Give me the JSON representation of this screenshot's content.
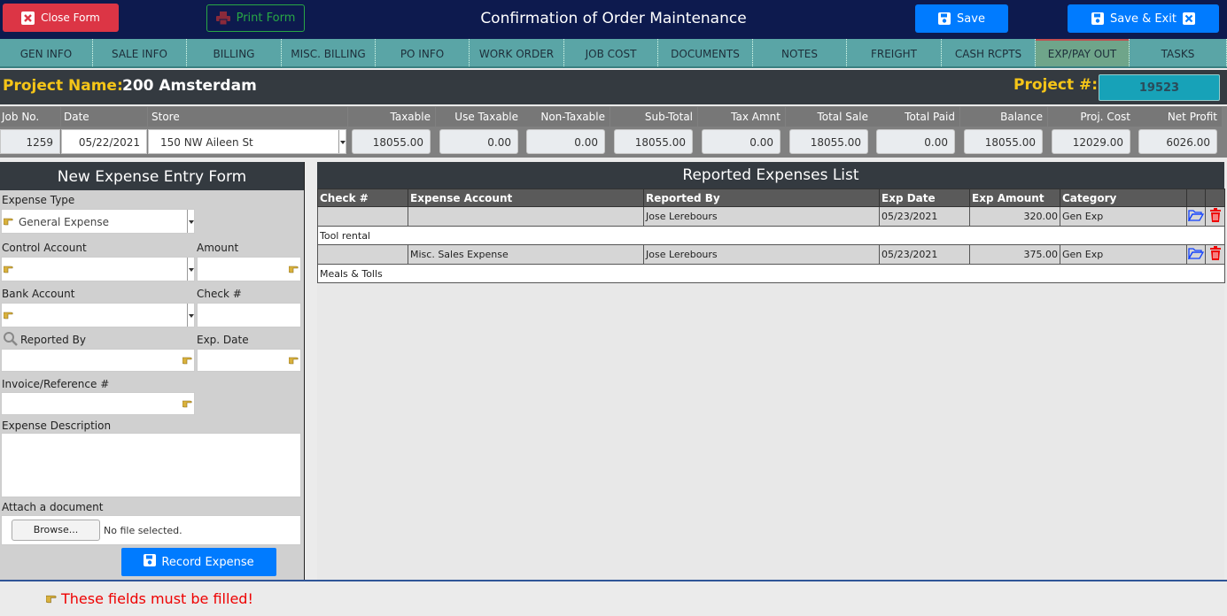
{
  "header": {
    "title": "Confirmation of Order Maintenance",
    "close_label": "Close Form",
    "print_label": "Print Form",
    "save_label": "Save",
    "save_exit_label": "Save & Exit"
  },
  "tabs": [
    {
      "label": "GEN INFO",
      "w": 105
    },
    {
      "label": "SALE INFO",
      "w": 106
    },
    {
      "label": "BILLING",
      "w": 107
    },
    {
      "label": "MISC. BILLING",
      "w": 106
    },
    {
      "label": "PO INFO",
      "w": 106
    },
    {
      "label": "WORK ORDER",
      "w": 107
    },
    {
      "label": "JOB COST",
      "w": 106
    },
    {
      "label": "DOCUMENTS",
      "w": 107
    },
    {
      "label": "NOTES",
      "w": 106
    },
    {
      "label": "FREIGHT",
      "w": 107
    },
    {
      "label": "CASH RCPTS",
      "w": 106
    },
    {
      "label": "EXP/PAY OUT",
      "w": 106,
      "active": true
    },
    {
      "label": "TASKS",
      "w": 110
    }
  ],
  "project": {
    "name_label": "Project Name:",
    "name": "200 Amsterdam",
    "num_label": "Project #:",
    "num": "19523"
  },
  "summary": {
    "job_no_label": "Job No.",
    "job_no": "1259",
    "date_label": "Date",
    "date": "05/22/2021",
    "store_label": "Store",
    "store": "150 NW Aileen St",
    "fields": [
      {
        "label": "Taxable",
        "value": "18055.00"
      },
      {
        "label": "Use Taxable",
        "value": "0.00"
      },
      {
        "label": "Non-Taxable",
        "value": "0.00"
      },
      {
        "label": "Sub-Total",
        "value": "18055.00"
      },
      {
        "label": "Tax Amnt",
        "value": "0.00"
      },
      {
        "label": "Total Sale",
        "value": "18055.00"
      },
      {
        "label": "Total Paid",
        "value": "0.00"
      },
      {
        "label": "Balance",
        "value": "18055.00"
      },
      {
        "label": "Proj. Cost",
        "value": "12029.00"
      },
      {
        "label": "Net Profit",
        "value": "6026.00"
      }
    ]
  },
  "form": {
    "title": "New Expense Entry Form",
    "expense_type_label": "Expense Type",
    "expense_type_value": "General Expense",
    "control_account_label": "Control Account",
    "amount_label": "Amount",
    "bank_account_label": "Bank Account",
    "check_label": "Check #",
    "reported_by_label": "Reported By",
    "exp_date_label": "Exp. Date",
    "invoice_label": "Invoice/Reference #",
    "description_label": "Expense Description",
    "attach_label": "Attach a document",
    "browse_label": "Browse...",
    "file_status": "No file selected.",
    "record_label": "Record Expense"
  },
  "expenses": {
    "title": "Reported Expenses List",
    "columns": [
      "Check #",
      "Expense Account",
      "Reported By",
      "Exp Date",
      "Exp Amount",
      "Category"
    ],
    "rows": [
      {
        "check": "",
        "account": "",
        "reported_by": "Jose Lerebours",
        "date": "05/23/2021",
        "amount": "320.00",
        "category": "Gen Exp",
        "description": "Tool rental"
      },
      {
        "check": "",
        "account": "Misc. Sales Expense",
        "reported_by": "Jose Lerebours",
        "date": "05/23/2021",
        "amount": "375.00",
        "category": "Gen Exp",
        "description": "Meals & Tolls"
      }
    ]
  },
  "footer": {
    "required_msg": "These fields must be filled!"
  }
}
